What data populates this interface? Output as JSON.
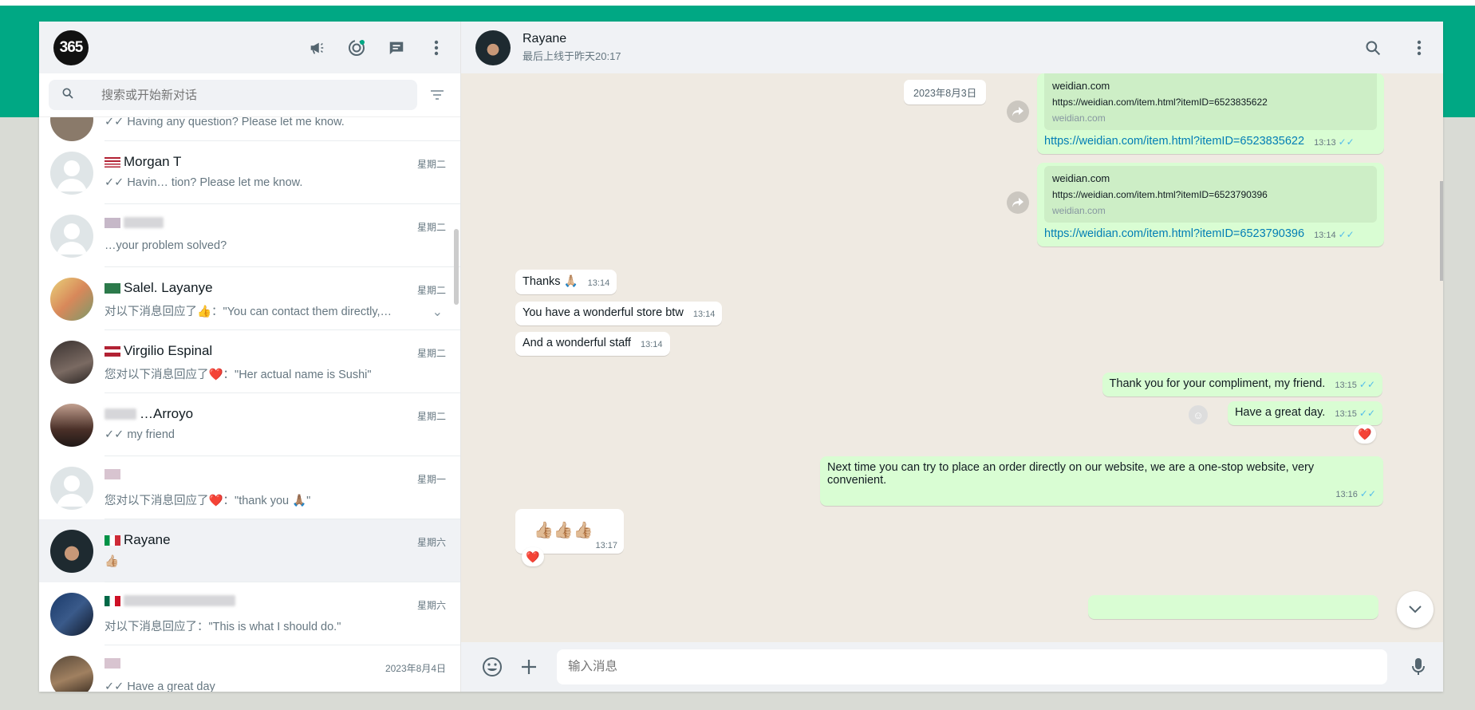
{
  "colors": {
    "accent": "#00a884",
    "outgoing_bubble": "#d9fdd3",
    "incoming_bubble": "#ffffff",
    "chat_bg": "#efeae2",
    "link": "#027eb5",
    "read_tick": "#53bdeb"
  },
  "app": {
    "logo_text": "365"
  },
  "left_header": {
    "icons": [
      "megaphone-icon",
      "status-icon",
      "new-chat-icon",
      "menu-icon"
    ]
  },
  "search": {
    "placeholder": "搜索或开始新对话"
  },
  "chats": [
    {
      "name": "",
      "flag": "",
      "time": "",
      "preview": "✓✓ Having any question? Please let me know.",
      "partial": true
    },
    {
      "name": "Morgan T",
      "flag": "us",
      "time": "星期二",
      "preview": "✓✓ Havin… tion? Please let me know."
    },
    {
      "name": "",
      "flag": "us",
      "time": "星期二",
      "preview": "…your problem solved?"
    },
    {
      "name": "Salel. Layanye",
      "flag": "sa",
      "time": "星期二",
      "preview": "对以下消息回应了👍：\"You can contact them directly,…"
    },
    {
      "name": "Virgilio Espinal",
      "flag": "us",
      "time": "星期二",
      "preview": "您对以下消息回应了❤️：\"Her actual name is Sushi\""
    },
    {
      "name": "…Arroyo",
      "flag": "",
      "time": "星期二",
      "preview": "✓✓ my friend"
    },
    {
      "name": "",
      "flag": "us",
      "time": "星期一",
      "preview": "您对以下消息回应了❤️：\"thank you 🙏🏽\""
    },
    {
      "name": "Rayane",
      "flag": "it",
      "time": "星期六",
      "preview": "👍🏼",
      "active": true
    },
    {
      "name": "",
      "flag": "mx",
      "time": "星期六",
      "preview": "对以下消息回应了：\"This is what I should do.\""
    },
    {
      "name": "",
      "flag": "us",
      "time": "2023年8月4日",
      "preview": "✓✓ Have a great day"
    }
  ],
  "conversation": {
    "contact_name": "Rayane",
    "status": "最后上线于昨天20:17",
    "date_chip": "2023年8月3日",
    "messages": [
      {
        "dir": "out",
        "type": "link",
        "card_title": "weidian.com",
        "card_url": "https://weidian.com/item.html?itemID=6523835622",
        "card_domain": "weidian.com",
        "text": "https://weidian.com/item.html?itemID=6523835622",
        "time": "13:13"
      },
      {
        "dir": "out",
        "type": "link",
        "card_title": "weidian.com",
        "card_url": "https://weidian.com/item.html?itemID=6523790396",
        "card_domain": "weidian.com",
        "text": "https://weidian.com/item.html?itemID=6523790396",
        "time": "13:14"
      },
      {
        "dir": "in",
        "text": "Thanks 🙏🏼",
        "time": "13:14"
      },
      {
        "dir": "in",
        "text": "You have a wonderful store btw",
        "time": "13:14"
      },
      {
        "dir": "in",
        "text": "And a wonderful staff",
        "time": "13:14"
      },
      {
        "dir": "out",
        "text": "Thank you for your compliment, my friend.",
        "time": "13:15"
      },
      {
        "dir": "out",
        "text": "Have a great day.",
        "time": "13:15",
        "reaction": "❤️"
      },
      {
        "dir": "out",
        "text": "Next time you can try to place an order directly on our website, we are a one-stop website, very convenient.",
        "time": "13:16"
      },
      {
        "dir": "in",
        "text": "👍🏼👍🏼👍🏼",
        "time": "13:17",
        "reaction": "❤️"
      }
    ]
  },
  "footer": {
    "placeholder": "输入消息"
  }
}
